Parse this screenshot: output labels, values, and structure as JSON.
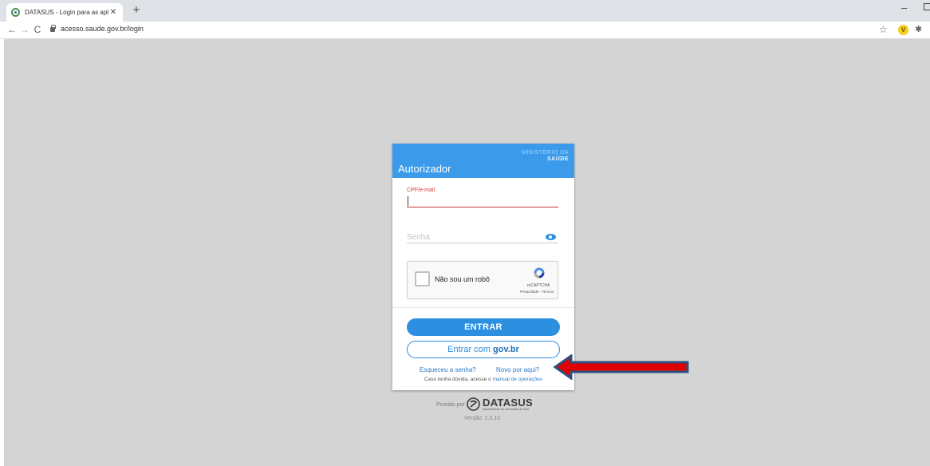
{
  "browser": {
    "tab_title": "DATASUS - Login para as aplicaç",
    "tab_close": "✕",
    "new_tab": "+",
    "url": "acesso.saude.gov.br/login",
    "minimize": "–",
    "back": "←",
    "forward": "→",
    "reload": "C",
    "star": "☆",
    "extension_letter": "V",
    "extensions": "✱",
    "icons": [
      "datasus-favicon-icon",
      "back-arrow-icon",
      "forward-arrow-icon",
      "reload-icon",
      "lock-icon",
      "star-icon",
      "extension-v-icon",
      "puzzle-icon"
    ]
  },
  "card": {
    "ministry_line1": "MINISTÉRIO DA",
    "ministry_line2": "SAÚDE",
    "title": "Autorizador",
    "cpf_label": "CPF/e-mail",
    "cpf_value": "",
    "senha_placeholder": "Senha",
    "captcha_label": "Não sou um robô",
    "captcha_brand": "reCAPTCHA",
    "captcha_terms": "Privacidade - Termos",
    "entrar_label": "ENTRAR",
    "govbr_prefix": "Entrar com ",
    "govbr_brand": "gov.br",
    "forgot_link": "Esqueceu a senha?",
    "new_link": "Novo por aqui?",
    "help_prefix": "Caso tenha dúvida, acesse o ",
    "help_link": "manual de operações"
  },
  "footer": {
    "provided_by": "Provido por",
    "datasus_name": "DATASUS",
    "datasus_sub": "Departamento de Informática do SUS",
    "version": "Versão: 2.0.10"
  },
  "colors": {
    "header_blue": "#3b9bea",
    "primary_blue": "#2c8fe0",
    "error_red": "#c23030",
    "page_bg": "#d4d4d4",
    "annotation_arrow": "#e00000",
    "annotation_arrow_border": "#2f4f7f"
  }
}
